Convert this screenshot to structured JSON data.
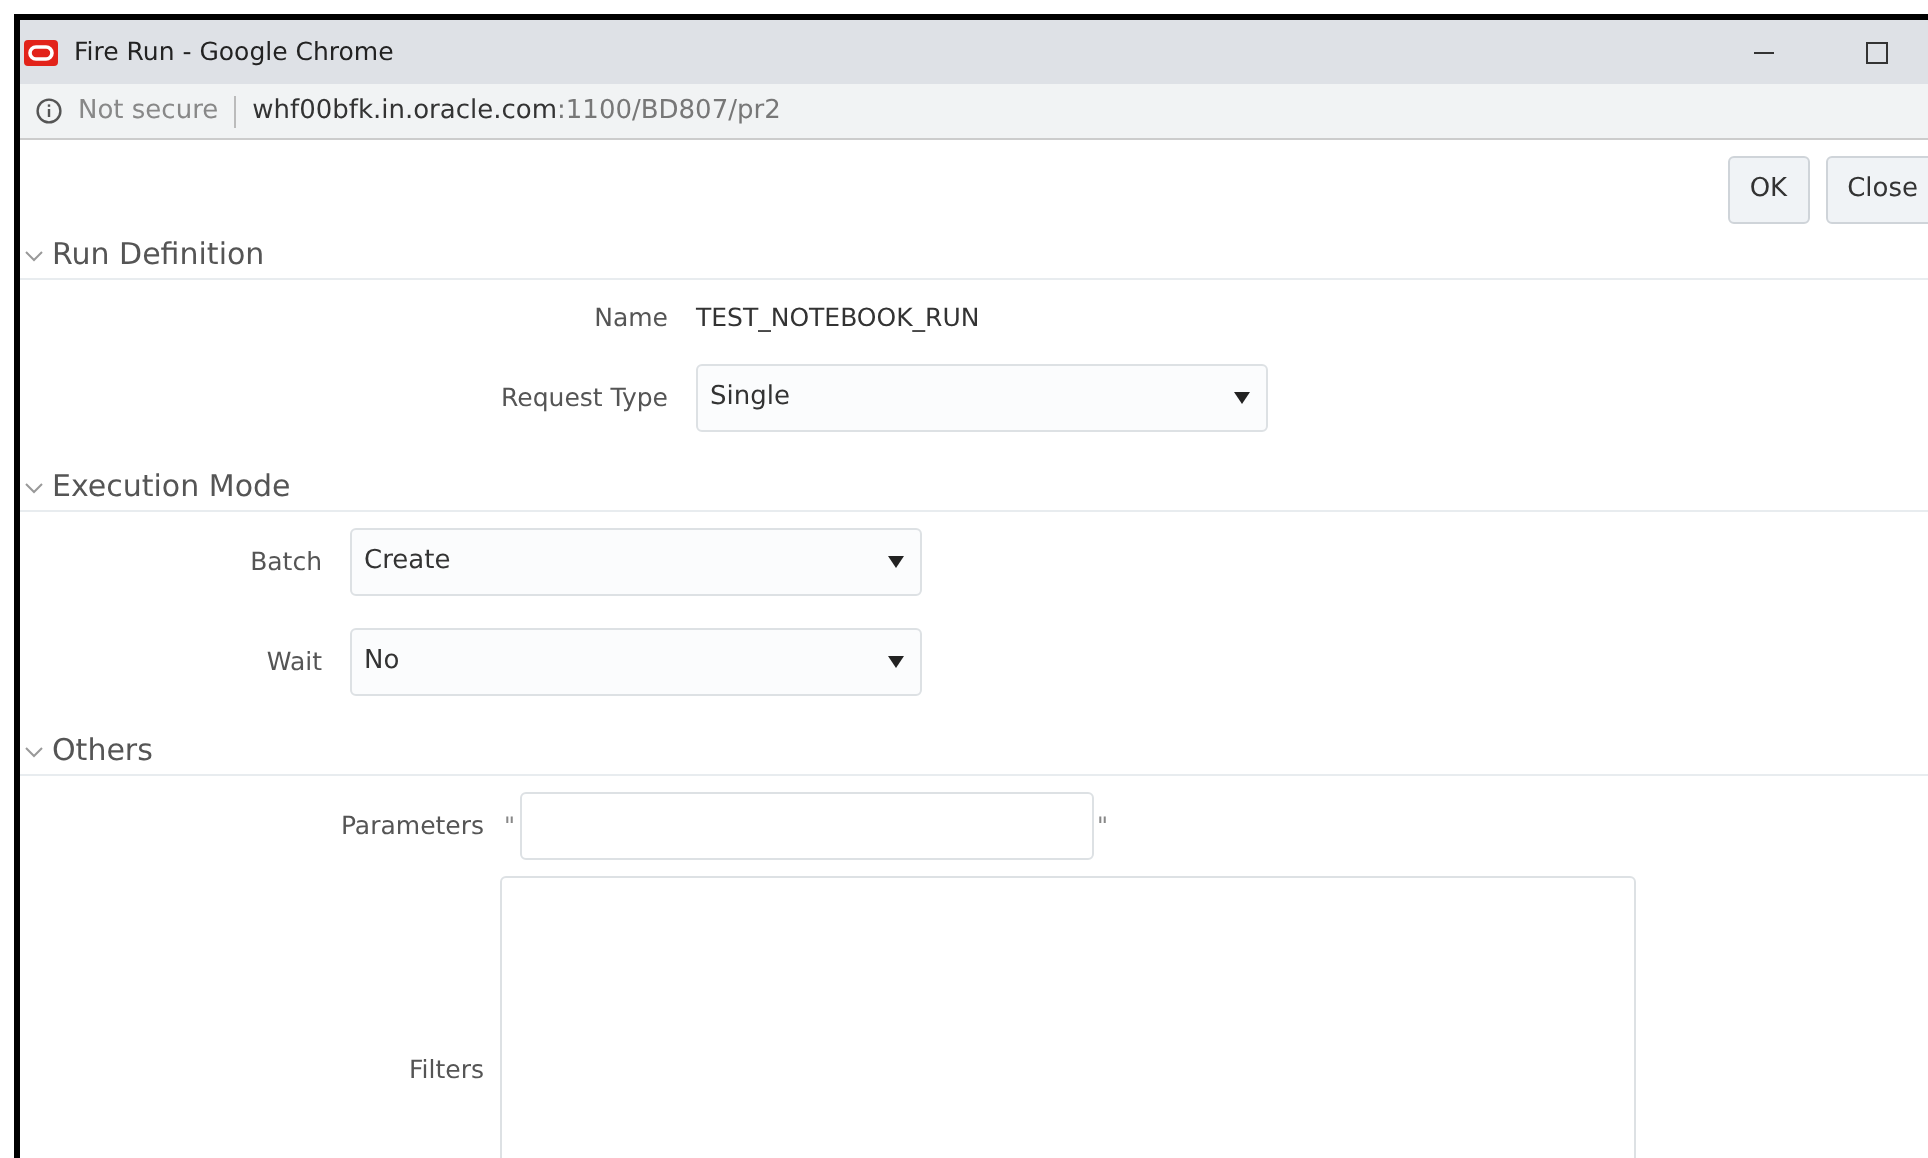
{
  "window": {
    "title": "Fire Run - Google Chrome"
  },
  "address_bar": {
    "security": "Not secure",
    "url_host": "whf00bfk.in.oracle.com",
    "url_path": ":1100/BD807/pr2"
  },
  "buttons": [
    {
      "label": "OK"
    },
    {
      "label": "Close"
    }
  ],
  "sections": [
    {
      "title": "Run Definition",
      "expanded": true,
      "fields": [
        {
          "label": "Name",
          "kind": "text",
          "value": "TEST_NOTEBOOK_RUN"
        },
        {
          "label": "Request Type",
          "kind": "select",
          "value": "Single"
        }
      ]
    },
    {
      "title": "Execution Mode",
      "expanded": true,
      "fields": [
        {
          "label": "Batch",
          "kind": "select",
          "value": "Create"
        },
        {
          "label": "Wait",
          "kind": "select",
          "value": "No"
        }
      ]
    },
    {
      "title": "Others",
      "expanded": true,
      "fields": [
        {
          "label": "Parameters",
          "kind": "input",
          "prefix": "\"",
          "suffix": "\""
        },
        {
          "label": "Filters",
          "kind": "textarea"
        }
      ]
    }
  ]
}
